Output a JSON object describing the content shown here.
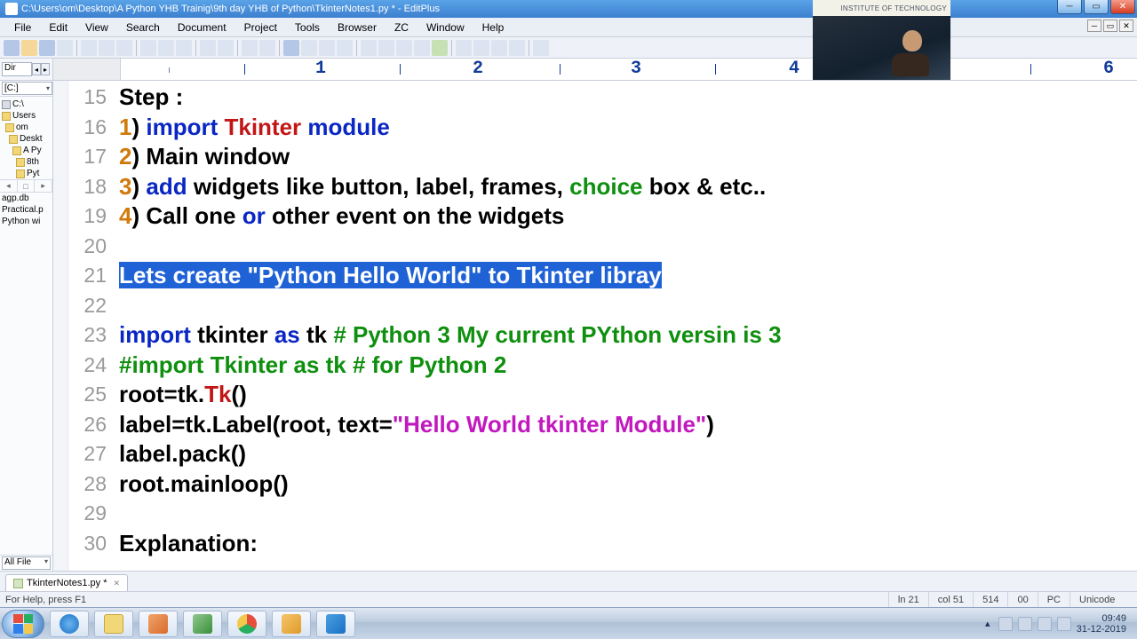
{
  "window": {
    "title": "C:\\Users\\om\\Desktop\\A Python YHB Trainig\\9th day YHB of Python\\TkinterNotes1.py * - EditPlus"
  },
  "menu": {
    "file": "File",
    "edit": "Edit",
    "view": "View",
    "search": "Search",
    "document": "Document",
    "project": "Project",
    "tools": "Tools",
    "browser": "Browser",
    "zc": "ZC",
    "window": "Window",
    "help": "Help"
  },
  "sidebar": {
    "dir_label": "Dir",
    "drive": "[C:]",
    "tree": {
      "n0": "C:\\",
      "n1": "Users",
      "n2": "om",
      "n3": "Deskt",
      "n4": "A Py",
      "n5": "8th",
      "n6": "Pyt"
    },
    "files": {
      "f0": "agp.db",
      "f1": "Practical.p",
      "f2": "Python wi"
    },
    "filter": "All File"
  },
  "ruler": {
    "m1": "1",
    "m2": "2",
    "m3": "3",
    "m4": "4",
    "m6": "6"
  },
  "code": {
    "ln15": "15",
    "ln16": "16",
    "ln17": "17",
    "ln18": "18",
    "ln19": "19",
    "ln20": "20",
    "ln21": "21",
    "ln22": "22",
    "ln23": "23",
    "ln24": "24",
    "ln25": "25",
    "ln26": "26",
    "ln27": "27",
    "ln28": "28",
    "ln29": "29",
    "ln30": "30",
    "l15_a": "Step :",
    "l16_a": "1",
    "l16_b": ") ",
    "l16_c": "import",
    "l16_d": " ",
    "l16_e": "Tkinter",
    "l16_f": " ",
    "l16_g": "module",
    "l17_a": "2",
    "l17_b": ") Main window",
    "l18_a": "3",
    "l18_b": ") ",
    "l18_c": "add",
    "l18_d": " widgets like button, label, frames, ",
    "l18_e": "choice",
    "l18_f": " box & etc..",
    "l19_a": "4",
    "l19_b": ") Call one ",
    "l19_c": "or",
    "l19_d": " other event on the widgets",
    "l21_a": "Lets create \"Python Hello World\" to Tkinter libray",
    "l23_a": "import",
    "l23_b": " tkinter ",
    "l23_c": "as",
    "l23_d": " tk ",
    "l23_e": "# Python 3 My current PYthon versin is 3",
    "l24_a": "#import Tkinter as tk # for Python 2",
    "l25_a": "root=tk.",
    "l25_b": "Tk",
    "l25_c": "()",
    "l26_a": "label=tk.Label(root, text=",
    "l26_b": "\"Hello World tkinter Module\"",
    "l26_c": ")",
    "l27_a": "label.pack()",
    "l28_a": "root.mainloop()",
    "l30_a": "Explanation:"
  },
  "tab": {
    "name": "TkinterNotes1.py *"
  },
  "status": {
    "hint": "For Help, press F1",
    "line": "ln 21",
    "col": "col 51",
    "chars": "514",
    "sel": "00",
    "mode": "PC",
    "enc": "Unicode"
  },
  "webcam": {
    "caption": "INSTITUTE OF TECHNOLOGY"
  },
  "tray": {
    "time": "09:49",
    "date": "31-12-2019"
  }
}
